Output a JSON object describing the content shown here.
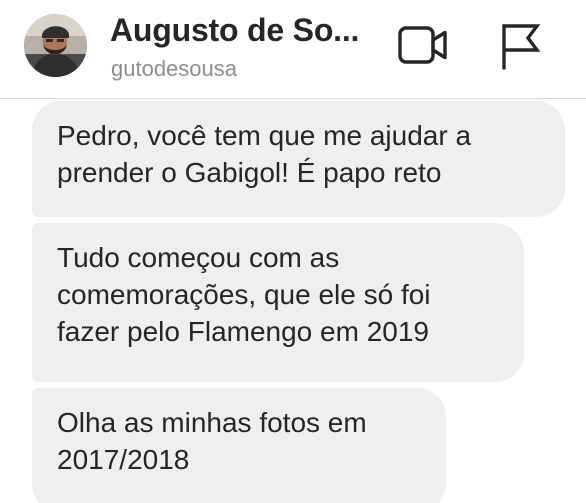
{
  "header": {
    "contact_name": "Augusto de So...",
    "username": "gutodesousa",
    "avatar_icon": "profile-photo",
    "video_icon": "video-camera-icon",
    "flag_icon": "flag-icon"
  },
  "messages": [
    {
      "text": "Pedro, você tem que me ajudar a\nprender o Gabigol! É papo reto"
    },
    {
      "text": "Tudo começou com as\ncomemorações, que ele só foi\nfazer pelo Flamengo em 2019"
    },
    {
      "text": "Olha as minhas fotos em\n2017/2018"
    }
  ],
  "colors": {
    "bubble_bg": "#efefef",
    "text": "#262626",
    "secondary_text": "#8e8e8e",
    "divider": "#dbdbdb"
  }
}
